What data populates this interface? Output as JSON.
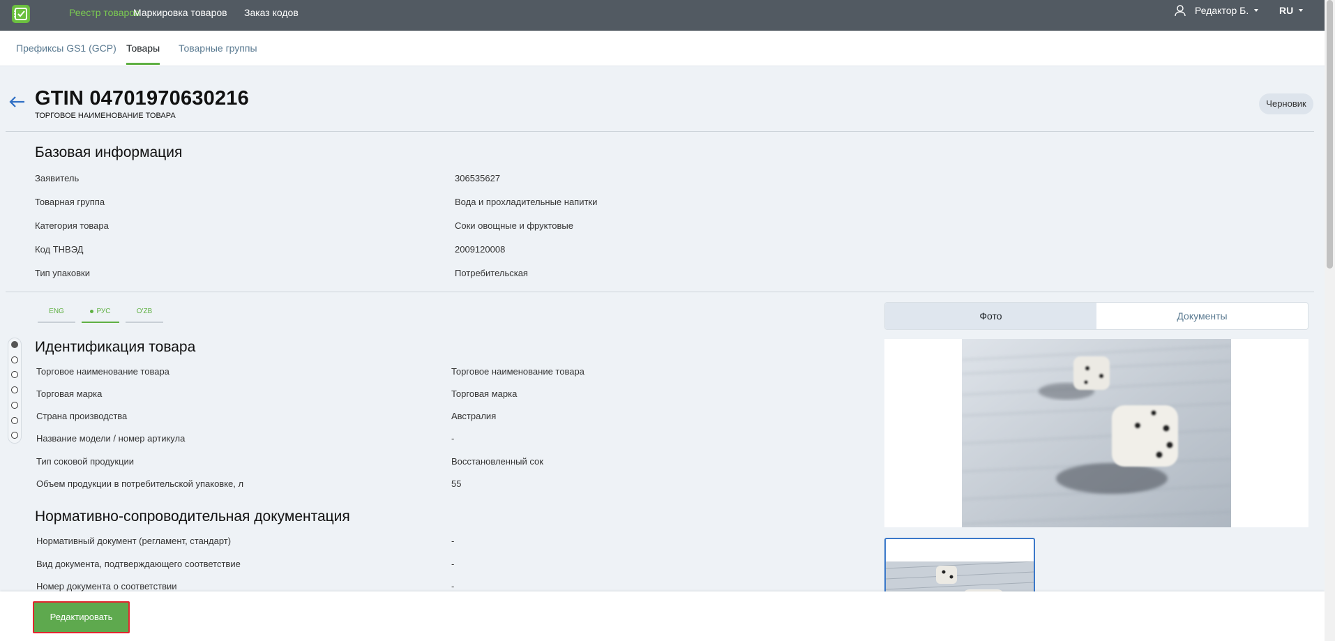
{
  "topbar": {
    "nav": [
      "Реестр товаров",
      "Маркировка товаров",
      "Заказ кодов"
    ],
    "user_name": "Редактор Б.",
    "language": "RU"
  },
  "subnav": {
    "tabs": [
      "Префиксы GS1 (GCP)",
      "Товары",
      "Товарные группы"
    ],
    "active_tab": "Товары"
  },
  "product": {
    "title": "GTIN 04701970630216",
    "subtitle": "ТОРГОВОЕ НАИМЕНОВАНИЕ ТОВАРА",
    "status": "Черновик"
  },
  "base_info": {
    "title": "Базовая информация",
    "rows": [
      {
        "label": "Заявитель",
        "value": "306535627"
      },
      {
        "label": "Товарная группа",
        "value": "Вода и прохладительные напитки"
      },
      {
        "label": "Категория товара",
        "value": "Соки овощные и фруктовые"
      },
      {
        "label": "Код ТНВЭД",
        "value": "2009120008"
      },
      {
        "label": "Тип упаковки",
        "value": "Потребительская"
      }
    ]
  },
  "language_tabs": [
    "ENG",
    "РУС",
    "O'ZB"
  ],
  "active_language": "РУС",
  "identification": {
    "title": "Идентификация товара",
    "rows": [
      {
        "label": "Торговое наименование товара",
        "value": "Торговое наименование товара"
      },
      {
        "label": "Торговая марка",
        "value": "Торговая марка"
      },
      {
        "label": "Страна производства",
        "value": "Австралия"
      },
      {
        "label": "Название модели / номер артикула",
        "value": "-"
      },
      {
        "label": "Тип соковой продукции",
        "value": "Восстановленный сок"
      },
      {
        "label": "Объем продукции в потребительской упаковке, л",
        "value": "55"
      }
    ]
  },
  "documentation": {
    "title": "Нормативно-сопроводительная документация",
    "rows": [
      {
        "label": "Нормативный документ (регламент, стандарт)",
        "value": "-"
      },
      {
        "label": "Вид документа, подтверждающего соответствие",
        "value": "-"
      },
      {
        "label": "Номер документа о соответствии",
        "value": "-"
      }
    ]
  },
  "media_tabs": [
    "Фото",
    "Документы"
  ],
  "active_media_tab": "Фото",
  "footer": {
    "edit_label": "Редактировать"
  },
  "colors": {
    "topbar": "#525a62",
    "accent_green": "#5fb043",
    "button_green": "#5ea94e",
    "highlight_red": "#e1262e"
  }
}
